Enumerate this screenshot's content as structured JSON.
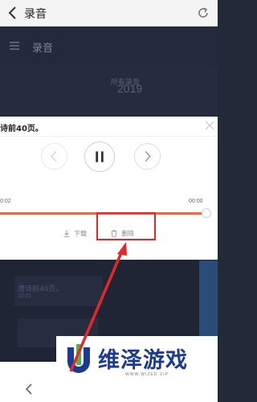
{
  "browser": {
    "title": "录音"
  },
  "app": {
    "title": "录音",
    "faded_label": "所有录音",
    "faded_year": "2019"
  },
  "dialog": {
    "title": "诗前40页。",
    "time_start": "0:02",
    "time_end": "00:00",
    "progress": 0.97,
    "download_label": "下载",
    "delete_label": "删除"
  },
  "list": {
    "item_title": "唐诗前40页。",
    "item_time": "10:01"
  },
  "logo": {
    "text": "维泽游戏",
    "subtext": "WWW.WIZED.VIP"
  },
  "colors": {
    "accent": "#f4673e",
    "highlight": "#e8262a",
    "brand": "#1c3a8f"
  }
}
